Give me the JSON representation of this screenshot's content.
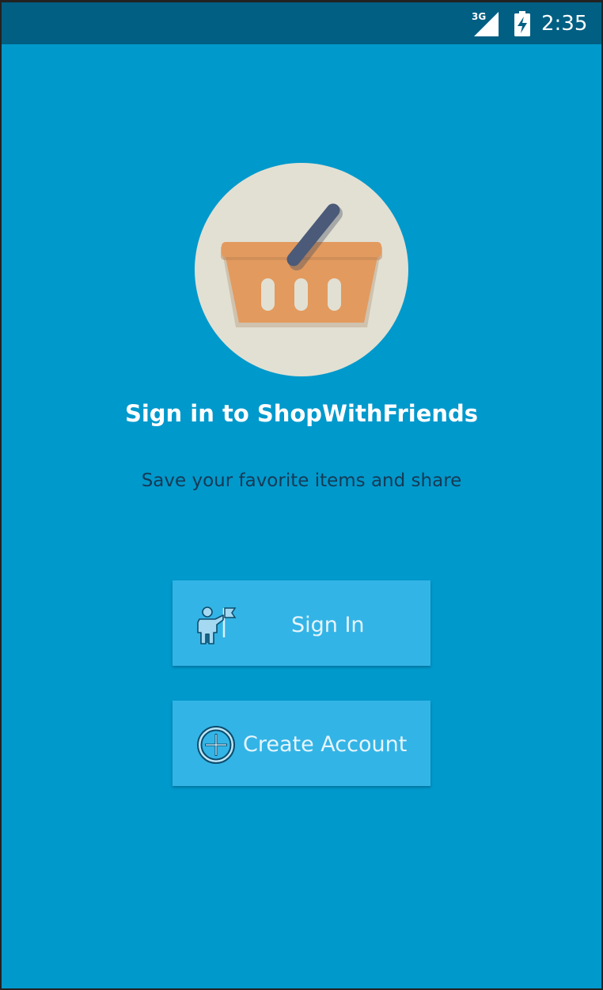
{
  "status_bar": {
    "network": "3G",
    "time": "2:35",
    "icons": [
      "signal-3g-icon",
      "battery-charging-icon"
    ]
  },
  "logo": {
    "icon": "shopping-basket-icon"
  },
  "title": "Sign in to ShopWithFriends",
  "subtitle": "Save your favorite items and share",
  "buttons": {
    "sign_in": {
      "label": "Sign In",
      "icon": "person-flag-icon"
    },
    "create_account": {
      "label": "Create Account",
      "icon": "plus-circle-icon"
    }
  },
  "colors": {
    "background": "#0099cc",
    "status_bar": "#005f82",
    "button": "#33b4e6",
    "logo_circle": "#e2e0d3",
    "basket": "#e39a5e",
    "handle": "#4b5a78",
    "subtitle_text": "#153a55"
  }
}
